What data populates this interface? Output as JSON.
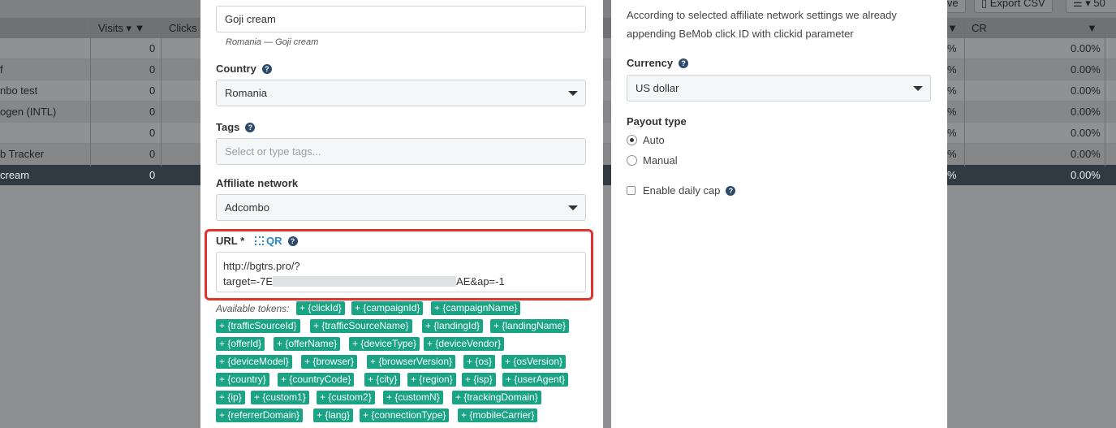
{
  "background_table": {
    "toolbar": {
      "archive_label": "ive",
      "export_label": "Export CSV",
      "rows_per_page": "50"
    },
    "headers": {
      "visits": "Visits",
      "clicks": "Clicks",
      "cr": "CR"
    },
    "rows": [
      {
        "name": "",
        "visits": "0",
        "left_pct": "%",
        "cr": "0.00%"
      },
      {
        "name": "f",
        "visits": "0",
        "left_pct": "%",
        "cr": "0.00%"
      },
      {
        "name": "nbo test",
        "visits": "0",
        "left_pct": "%",
        "cr": "0.00%"
      },
      {
        "name": "ogen (INTL)",
        "visits": "0",
        "left_pct": "%",
        "cr": "0.00%"
      },
      {
        "name": "",
        "visits": "0",
        "left_pct": "%",
        "cr": "0.00%"
      },
      {
        "name": "b Tracker",
        "visits": "0",
        "left_pct": "%",
        "cr": "0.00%"
      },
      {
        "name": " cream",
        "visits": "0",
        "left_pct": "%",
        "cr": "0.00%"
      }
    ]
  },
  "form": {
    "offer_name": {
      "value": "Goji cream",
      "hint": "Romania — Goji cream"
    },
    "country": {
      "label": "Country",
      "value": "Romania"
    },
    "tags": {
      "label": "Tags",
      "placeholder": "Select or type tags..."
    },
    "affiliate_network": {
      "label": "Affiliate network",
      "value": "Adcombo"
    },
    "url": {
      "label": "URL *",
      "qr_label": "QR",
      "line1": "http://bgtrs.pro/?",
      "line2_start": "target=-7E",
      "line2_end": "AE&ap=-1"
    },
    "tokens": {
      "label": "Available tokens:",
      "items": [
        "+ {clickId}",
        "+ {campaignId}",
        "+ {campaignName}",
        "+ {trafficSourceId}",
        "+ {trafficSourceName}",
        "+ {landingId}",
        "+ {landingName}",
        "+ {offerId}",
        "+ {offerName}",
        "+ {deviceType}",
        "+ {deviceVendor}",
        "+ {deviceModel}",
        "+ {browser}",
        "+ {browserVersion}",
        "+ {os}",
        "+ {osVersion}",
        "+ {country}",
        "+ {countryCode}",
        "+ {city}",
        "+ {region}",
        "+ {isp}",
        "+ {userAgent}",
        "+ {ip}",
        "+ {custom1}",
        "+ {custom2}",
        "+ {customN}",
        "+ {trackingDomain}",
        "+ {referrerDomain}",
        "+ {lang}",
        "+ {connectionType}",
        "+ {mobileCarrier}"
      ]
    }
  },
  "right": {
    "info_line1": "According to selected affiliate network settings we already",
    "info_line2": "appending BeMob click ID with clickid parameter",
    "currency": {
      "label": "Currency",
      "value": "US dollar"
    },
    "payout": {
      "label": "Payout type",
      "auto": "Auto",
      "manual": "Manual",
      "selected": "Auto"
    },
    "daily_cap": {
      "label": "Enable daily cap",
      "checked": false
    }
  },
  "colors": {
    "token_bg": "#1aa384",
    "highlight": "#e2332c",
    "link": "#2a87c2"
  }
}
